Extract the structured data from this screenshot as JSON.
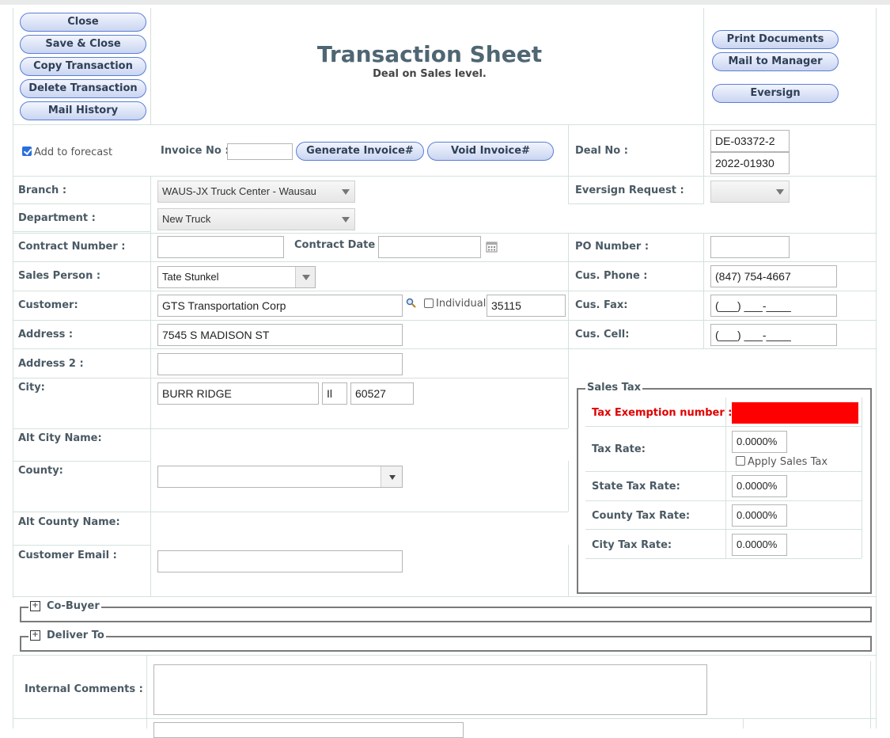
{
  "header": {
    "title": "Transaction Sheet",
    "subtitle": "Deal on Sales level.",
    "left_buttons": [
      "Close",
      "Save & Close",
      "Copy Transaction",
      "Delete Transaction",
      "Mail History"
    ],
    "right_buttons": [
      "Print Documents",
      "Mail to Manager",
      "Eversign"
    ]
  },
  "invoice": {
    "add_to_forecast_label": "Add to forecast",
    "add_to_forecast_checked": true,
    "invoice_no_label": "Invoice No :",
    "invoice_no_value": "",
    "generate_label": "Generate Invoice#",
    "void_label": "Void Invoice#",
    "deal_no_label": "Deal No :",
    "deal_no_value": "DE-03372-2",
    "deal_no_value2": "2022-01930"
  },
  "form": {
    "branch_label": "Branch :",
    "branch_value": "WAUS-JX Truck Center - Wausau",
    "eversign_request_label": "Eversign Request :",
    "eversign_request_value": "",
    "department_label": "Department :",
    "department_value": "New Truck",
    "contract_number_label": "Contract Number :",
    "contract_number_value": "",
    "contract_date_label": "Contract Date :",
    "contract_date_value": "",
    "po_number_label": "PO Number :",
    "po_number_value": "",
    "sales_person_label": "Sales Person :",
    "sales_person_value": "Tate Stunkel",
    "cus_phone_label": "Cus. Phone :",
    "cus_phone_value": "(847) 754-4667",
    "customer_label": "Customer:",
    "customer_value": "GTS Transportation Corp",
    "individual_label": "Individual",
    "customer_id_value": "35115",
    "cus_fax_label": "Cus. Fax:",
    "cus_fax_value": "(___) ___-____",
    "address_label": "Address :",
    "address_value": "7545 S MADISON ST",
    "cus_cell_label": "Cus. Cell:",
    "cus_cell_value": "(___) ___-____",
    "address2_label": "Address 2 :",
    "address2_value": "",
    "city_label": "City:",
    "city_value": "BURR RIDGE",
    "state_value": "Il",
    "zip_value": "60527",
    "alt_city_label": "Alt City Name:",
    "county_label": "County:",
    "county_value": "",
    "alt_county_label": "Alt County Name:",
    "customer_email_label": "Customer Email :",
    "customer_email_value": ""
  },
  "sales_tax": {
    "legend": "Sales Tax",
    "tax_exemption_label": "Tax Exemption number :",
    "tax_exemption_value": "",
    "tax_rate_label": "Tax Rate:",
    "tax_rate_value": "0.0000%",
    "apply_sales_tax_label": "Apply Sales Tax",
    "state_tax_label": "State Tax Rate:",
    "state_tax_value": "0.0000%",
    "county_tax_label": "County Tax Rate:",
    "county_tax_value": "0.0000%",
    "city_tax_label": "City Tax Rate:",
    "city_tax_value": "0.0000%",
    "alert_color": "#ff0000",
    "alert_label_color": "#e00000"
  },
  "sections": {
    "co_buyer_label": "Co-Buyer",
    "deliver_to_label": "Deliver To",
    "internal_comments_label": "Internal Comments :",
    "internal_comments_value": ""
  }
}
